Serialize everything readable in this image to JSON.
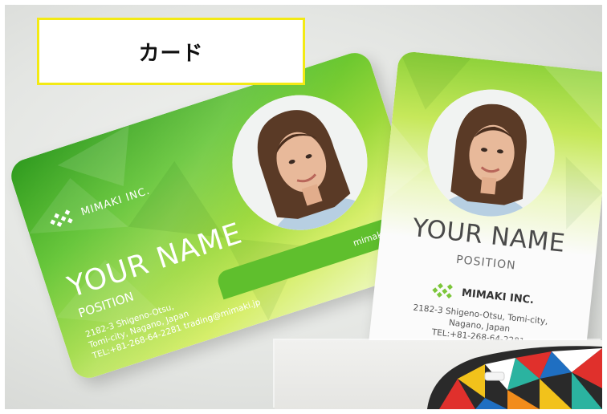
{
  "label": {
    "text": "カード"
  },
  "landscape_card": {
    "company": "MIMAKI INC.",
    "name": "YOUR NAME",
    "position": "POSITION",
    "address_line1": "2182-3 Shigeno-Otsu,",
    "address_line2": "Tomi-city, Nagano, Japan",
    "contact": "TEL:+81-268-64-2281  trading@mimaki.jp",
    "url": "mimaki.com"
  },
  "portrait_card": {
    "name": "YOUR NAME",
    "position": "POSITION",
    "company": "MIMAKI INC.",
    "address_line1": "2182-3 Shigeno-Otsu, Tomi-city,",
    "address_line2": "Nagano, Japan",
    "tel": "TEL:+81-268-64-2281"
  },
  "colors": {
    "label_border": "#f3ea14",
    "card_green": "#5cc22c",
    "card_lime": "#d6ee6a"
  }
}
